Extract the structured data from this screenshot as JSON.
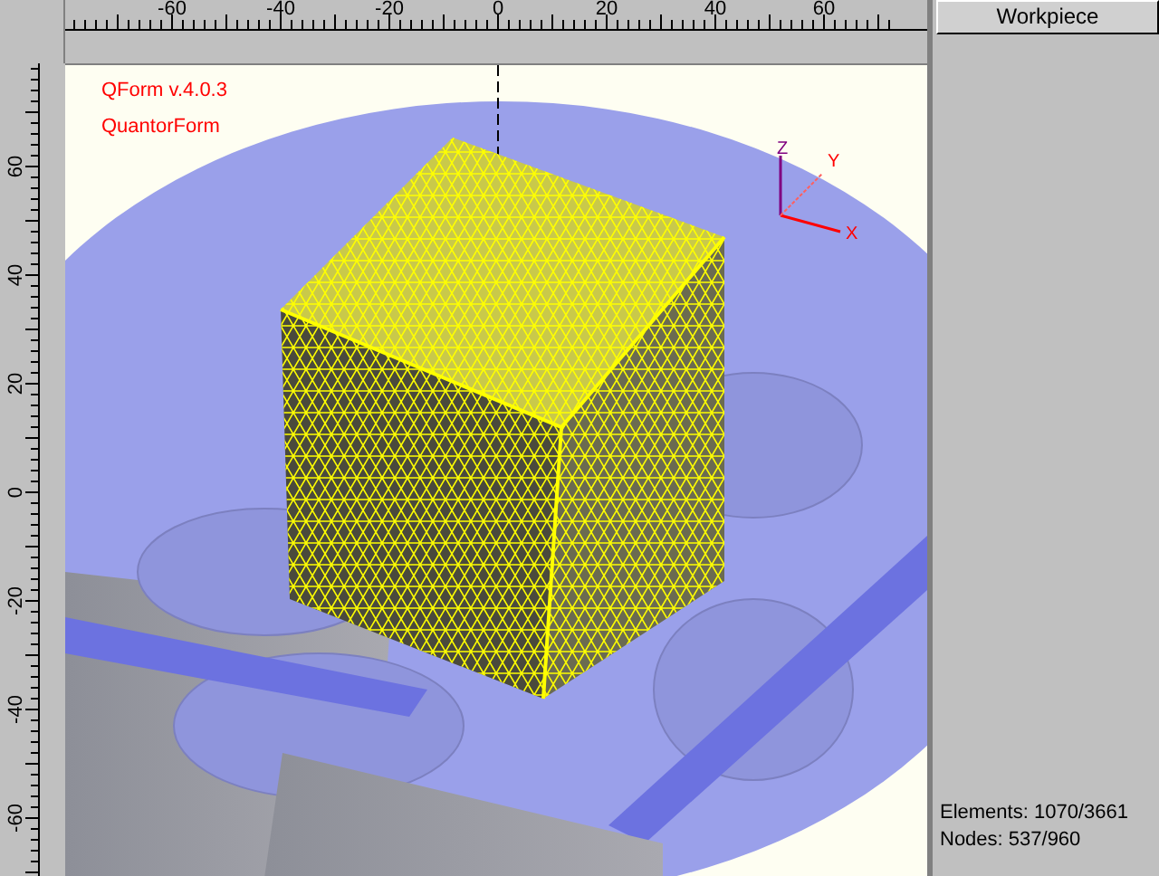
{
  "rulers": {
    "horizontal": [
      "-60",
      "-40",
      "-20",
      "0",
      "20",
      "40",
      "60"
    ],
    "vertical": [
      "60",
      "40",
      "20",
      "0",
      "-20",
      "-40",
      "-60"
    ]
  },
  "viewport": {
    "labels": [
      "QForm v.4.0.3",
      "QuantorForm"
    ],
    "axes": [
      "X",
      "Y",
      "Z"
    ]
  },
  "panel": {
    "title": "Workpiece",
    "stats": [
      "Elements: 1070/3661",
      "Nodes: 537/960"
    ]
  }
}
